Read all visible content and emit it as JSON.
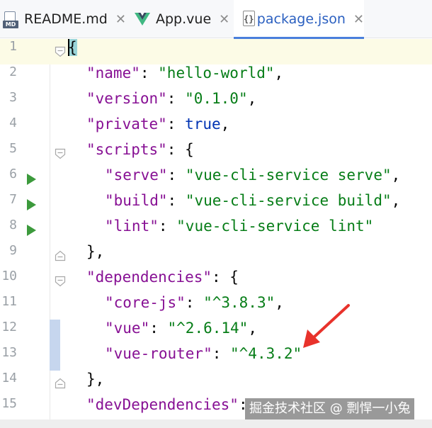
{
  "tabs": [
    {
      "label": "README.md",
      "icon": "markdown-file-icon",
      "icon_badge": "MD",
      "active": false
    },
    {
      "label": "App.vue",
      "icon": "vue-file-icon",
      "active": false
    },
    {
      "label": "package.json",
      "icon": "json-file-icon",
      "icon_badge": "{}",
      "active": true
    }
  ],
  "close_glyph": "✕",
  "editor": {
    "line_numbers": [
      "1",
      "2",
      "3",
      "4",
      "5",
      "6",
      "7",
      "8",
      "9",
      "10",
      "11",
      "12",
      "13",
      "14",
      "15"
    ],
    "lines": [
      {
        "tokens": []
      },
      {
        "tokens": [
          {
            "t": "\"name\"",
            "c": "k"
          },
          {
            "t": ": ",
            "c": "p"
          },
          {
            "t": "\"hello-world\"",
            "c": "s"
          },
          {
            "t": ",",
            "c": "p"
          }
        ]
      },
      {
        "tokens": [
          {
            "t": "\"version\"",
            "c": "k"
          },
          {
            "t": ": ",
            "c": "p"
          },
          {
            "t": "\"0.1.0\"",
            "c": "s"
          },
          {
            "t": ",",
            "c": "p"
          }
        ]
      },
      {
        "tokens": [
          {
            "t": "\"private\"",
            "c": "k"
          },
          {
            "t": ": ",
            "c": "p"
          },
          {
            "t": "true",
            "c": "b"
          },
          {
            "t": ",",
            "c": "p"
          }
        ]
      },
      {
        "tokens": [
          {
            "t": "\"scripts\"",
            "c": "k"
          },
          {
            "t": ": {",
            "c": "p"
          }
        ]
      },
      {
        "tokens": [
          {
            "t": "\"serve\"",
            "c": "k"
          },
          {
            "t": ": ",
            "c": "p"
          },
          {
            "t": "\"vue-cli-service serve\"",
            "c": "s"
          },
          {
            "t": ",",
            "c": "p"
          }
        ]
      },
      {
        "tokens": [
          {
            "t": "\"build\"",
            "c": "k"
          },
          {
            "t": ": ",
            "c": "p"
          },
          {
            "t": "\"vue-cli-service build\"",
            "c": "s"
          },
          {
            "t": ",",
            "c": "p"
          }
        ]
      },
      {
        "tokens": [
          {
            "t": "\"lint\"",
            "c": "k"
          },
          {
            "t": ": ",
            "c": "p"
          },
          {
            "t": "\"vue-cli-service lint\"",
            "c": "s"
          }
        ]
      },
      {
        "tokens": [
          {
            "t": "},",
            "c": "p"
          }
        ]
      },
      {
        "tokens": [
          {
            "t": "\"dependencies\"",
            "c": "k"
          },
          {
            "t": ": {",
            "c": "p"
          }
        ]
      },
      {
        "tokens": [
          {
            "t": "\"core-js\"",
            "c": "k"
          },
          {
            "t": ": ",
            "c": "p"
          },
          {
            "t": "\"^3.8.3\"",
            "c": "s"
          },
          {
            "t": ",",
            "c": "p"
          }
        ]
      },
      {
        "tokens": [
          {
            "t": "\"vue\"",
            "c": "k"
          },
          {
            "t": ": ",
            "c": "p"
          },
          {
            "t": "\"^2.6.14\"",
            "c": "s"
          },
          {
            "t": ",",
            "c": "p"
          }
        ]
      },
      {
        "tokens": [
          {
            "t": "\"vue-router\"",
            "c": "k"
          },
          {
            "t": ": ",
            "c": "p"
          },
          {
            "t": "\"^4.3.2\"",
            "c": "s"
          }
        ]
      },
      {
        "tokens": [
          {
            "t": "},",
            "c": "p"
          }
        ]
      },
      {
        "tokens": [
          {
            "t": "\"devDependencies\"",
            "c": "k"
          },
          {
            "t": ": ",
            "c": "p"
          }
        ]
      }
    ],
    "opening_brace": "{",
    "run_lines": [
      "6",
      "7",
      "8"
    ]
  },
  "watermark": "掘金技术社区 @ 剽悍一小兔",
  "colors": {
    "key": "#871094",
    "string": "#067d17",
    "keyword": "#0033b3",
    "active_tab_text": "#2a5fc0",
    "run_icon": "#3c9a3c",
    "annotation_arrow": "#e8322b"
  }
}
